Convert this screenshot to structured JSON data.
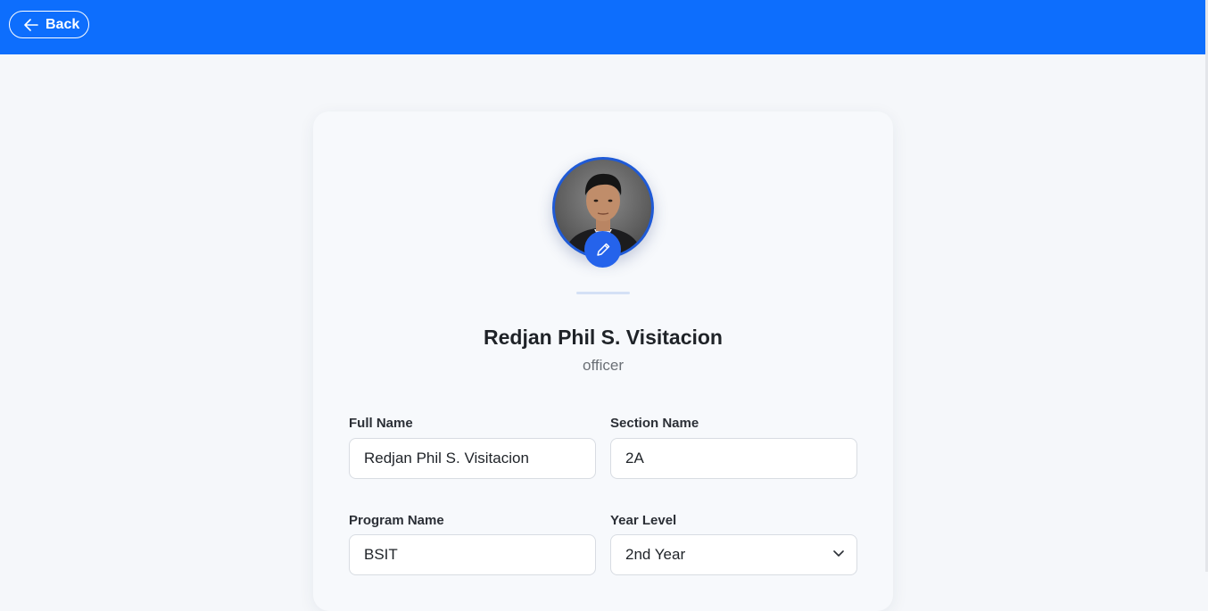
{
  "header": {
    "back_label": "Back",
    "accent_color": "#0d6efd"
  },
  "profile": {
    "name": "Redjan Phil S. Visitacion",
    "role": "officer"
  },
  "form": {
    "full_name_label": "Full Name",
    "full_name_value": "Redjan Phil S. Visitacion",
    "section_name_label": "Section Name",
    "section_name_value": "2A",
    "program_name_label": "Program Name",
    "program_name_value": "BSIT",
    "year_level_label": "Year Level",
    "year_level_value": "2nd Year"
  },
  "icons": {
    "back": "arrow-left-icon",
    "edit": "pencil-icon",
    "select": "chevron-down-icon"
  }
}
